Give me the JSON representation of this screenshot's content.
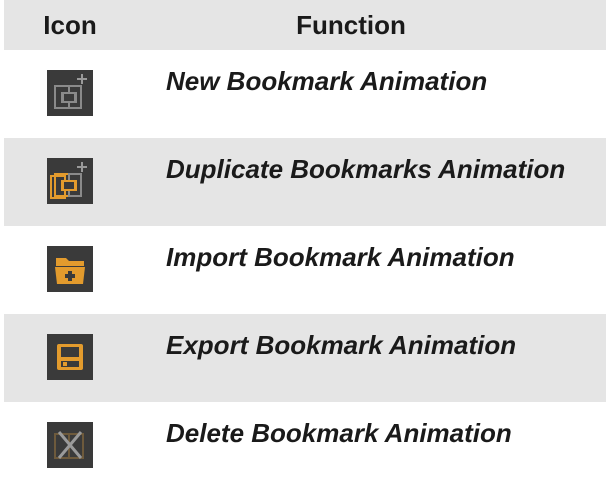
{
  "table": {
    "header": {
      "icon_col": "Icon",
      "function_col": "Function"
    },
    "rows": [
      {
        "icon": "new-bookmark-animation-icon",
        "label": "New Bookmark Animation"
      },
      {
        "icon": "duplicate-bookmarks-animation-icon",
        "label": "Duplicate Bookmarks Animation"
      },
      {
        "icon": "import-bookmark-animation-icon",
        "label": "Import Bookmark Animation"
      },
      {
        "icon": "export-bookmark-animation-icon",
        "label": "Export Bookmark Animation"
      },
      {
        "icon": "delete-bookmark-animation-icon",
        "label": "Delete Bookmark Animation"
      }
    ]
  },
  "colors": {
    "header_bg": "#e5e5e5",
    "shade_bg": "#e5e5e5",
    "icon_bg": "#3a3a3a",
    "icon_orange": "#e39b2d",
    "icon_gray": "#8a8a8a"
  }
}
